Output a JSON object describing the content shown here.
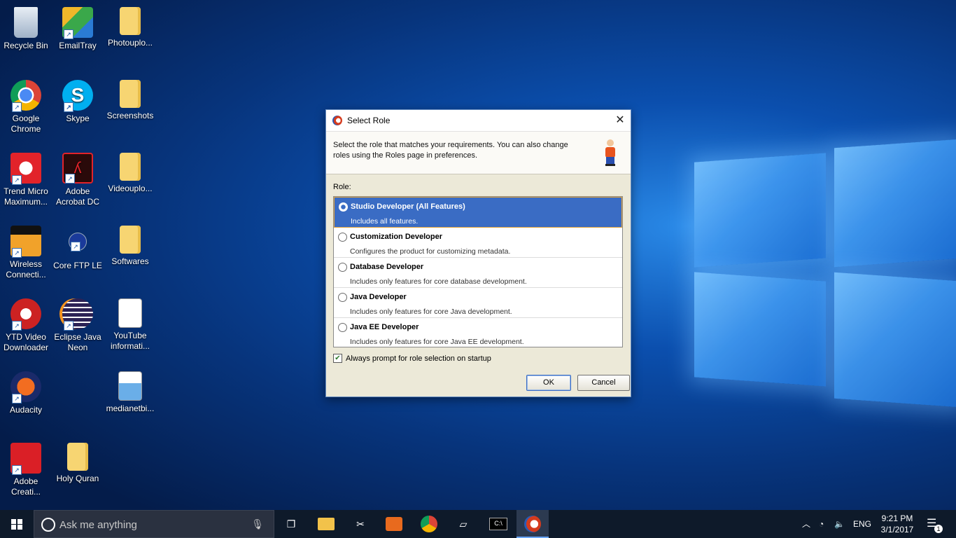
{
  "desktop": {
    "icons": [
      {
        "label": "Recycle Bin",
        "icon": "recycle-bin-icon"
      },
      {
        "label": "EmailTray",
        "icon": "emailtray-icon"
      },
      {
        "label": "Photouplo...",
        "icon": "folder-icon"
      },
      {
        "label": "Google Chrome",
        "icon": "chrome-icon"
      },
      {
        "label": "Skype",
        "icon": "skype-icon"
      },
      {
        "label": "Screenshots",
        "icon": "folder-icon"
      },
      {
        "label": "Trend Micro Maximum...",
        "icon": "trend-micro-icon"
      },
      {
        "label": "Adobe Acrobat DC",
        "icon": "acrobat-icon"
      },
      {
        "label": "Videouplo...",
        "icon": "folder-icon"
      },
      {
        "label": "Wireless Connecti...",
        "icon": "dlink-icon"
      },
      {
        "label": "Core FTP LE",
        "icon": "coreftp-icon"
      },
      {
        "label": "Softwares",
        "icon": "folder-icon"
      },
      {
        "label": "YTD Video Downloader",
        "icon": "ytd-icon"
      },
      {
        "label": "Eclipse Java Neon",
        "icon": "eclipse-icon"
      },
      {
        "label": "YouTube informati...",
        "icon": "document-icon"
      },
      {
        "label": "Audacity",
        "icon": "audacity-icon"
      },
      {
        "label": "medianetbi...",
        "icon": "image-file-icon"
      },
      {
        "label": "Adobe Creati...",
        "icon": "creative-cloud-icon"
      },
      {
        "label": "Holy Quran",
        "icon": "folder-icon"
      }
    ]
  },
  "dialog": {
    "title": "Select Role",
    "description": "Select the role that matches your requirements. You can also change roles using the Roles page in preferences.",
    "role_label": "Role:",
    "roles": [
      {
        "name": "Studio Developer (All Features)",
        "desc": "Includes all features.",
        "selected": true
      },
      {
        "name": "Customization Developer",
        "desc": "Configures the product for customizing metadata.",
        "selected": false
      },
      {
        "name": "Database Developer",
        "desc": "Includes only features for core database development.",
        "selected": false
      },
      {
        "name": "Java Developer",
        "desc": "Includes only features for core Java development.",
        "selected": false
      },
      {
        "name": "Java EE Developer",
        "desc": "Includes only features for core Java EE development.",
        "selected": false
      }
    ],
    "always_prompt_label": "Always prompt for role selection on startup",
    "always_prompt_checked": true,
    "ok_label": "OK",
    "cancel_label": "Cancel"
  },
  "taskbar": {
    "search_placeholder": "Ask me anything",
    "language": "ENG",
    "time": "9:21 PM",
    "date": "3/1/2017",
    "notification_count": "1"
  },
  "colors": {
    "accent": "#3a6cc4",
    "dialog_bg": "#ece9d8",
    "taskbar_bg": "#0e1a2a"
  }
}
